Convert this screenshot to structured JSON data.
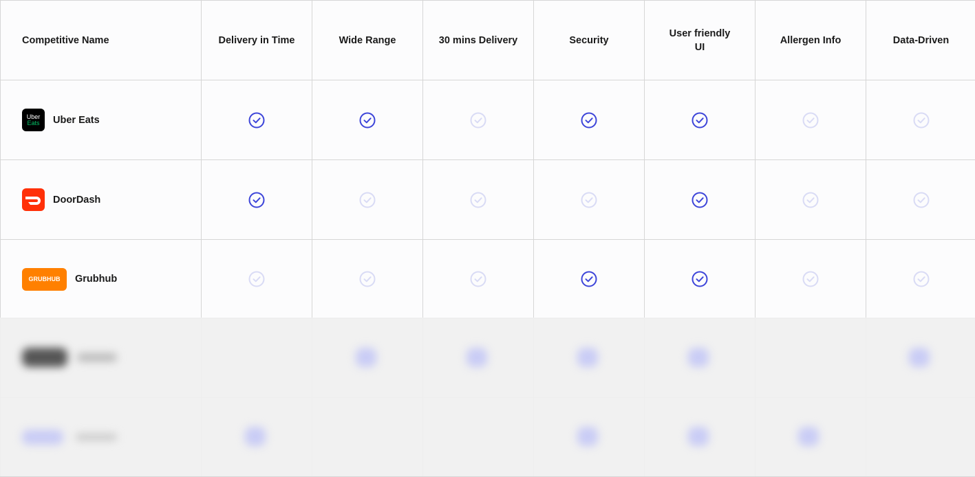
{
  "columns": {
    "name": "Competitive Name",
    "features": [
      "Delivery in Time",
      "Wide Range",
      "30 mins Delivery",
      "Security",
      "User friendly\nUI",
      "Allergen Info",
      "Data-Driven"
    ]
  },
  "rows": [
    {
      "name": "Uber Eats",
      "logo": "uber-eats-logo",
      "logo_text": [
        "Uber",
        "Eats"
      ],
      "checks": [
        true,
        true,
        false,
        true,
        true,
        false,
        false
      ]
    },
    {
      "name": "DoorDash",
      "logo": "doordash-logo",
      "checks": [
        true,
        false,
        false,
        false,
        true,
        false,
        false
      ]
    },
    {
      "name": "Grubhub",
      "logo": "grubhub-logo",
      "logo_text": [
        "GRUBHUB"
      ],
      "checks": [
        false,
        false,
        false,
        true,
        true,
        false,
        false
      ]
    }
  ],
  "colors": {
    "check_active": "#3d45d9",
    "check_inactive": "#d9dbf5",
    "uber_bg": "#000000",
    "uber_green": "#06c167",
    "doordash_red": "#ff3008",
    "grubhub_orange": "#ff8000"
  }
}
